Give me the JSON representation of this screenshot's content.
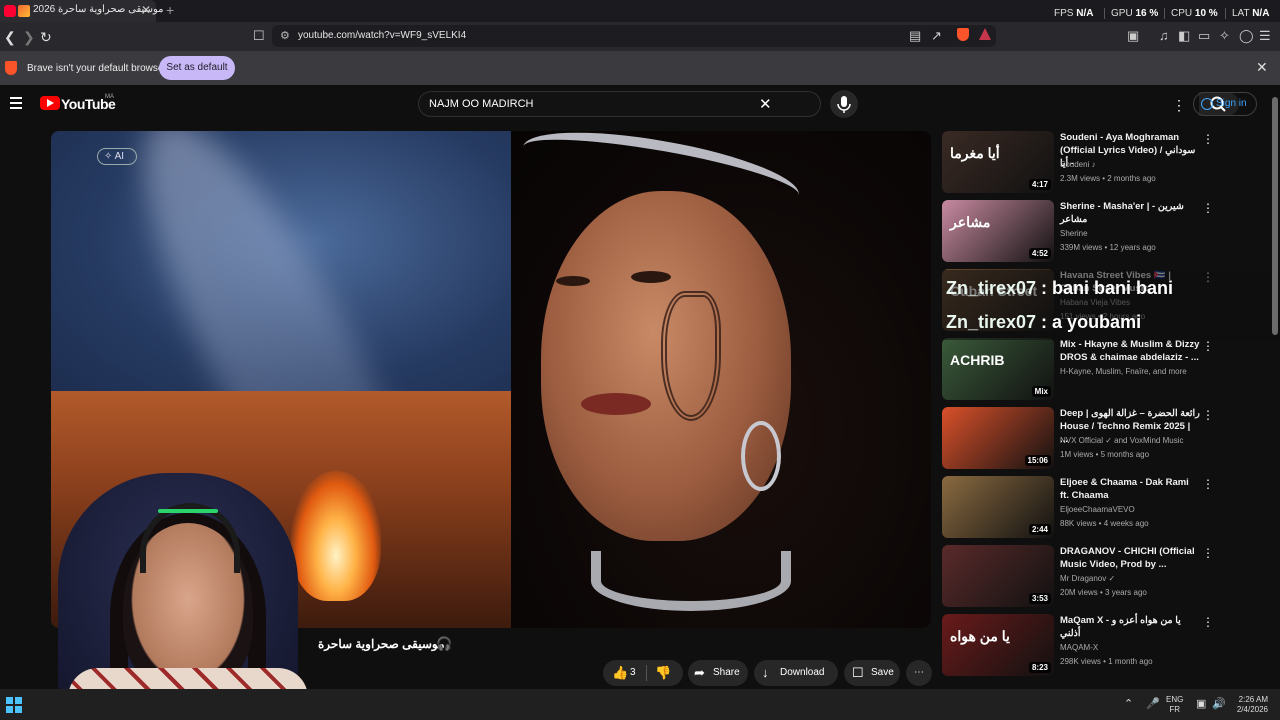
{
  "browser": {
    "tab_title": "موسيقى صحراوية ساحرة 2026",
    "tab_close": "✕",
    "new_tab": "+",
    "perf": {
      "fps_label": "FPS",
      "fps_value": "N/A",
      "gpu_label": "GPU",
      "gpu_value": "16 %",
      "cpu_label": "CPU",
      "cpu_value": "10 %",
      "lat_label": "LAT",
      "lat_value": "N/A"
    },
    "url": "youtube.com/watch?v=WF9_sVELKI4",
    "infobar_message": "Brave isn't your default browser",
    "set_default_label": "Set as default",
    "infobar_close": "✕"
  },
  "youtube": {
    "logo_text": "YouTube",
    "country_code": "MA",
    "search_query": "NAJM OO MADIRCH",
    "signin_label": "Sign in",
    "player": {
      "ai_badge": "AI"
    },
    "video_title": "موسيقى صحراوية ساحرة",
    "actions": {
      "like_count": "3",
      "share_label": "Share",
      "download_label": "Download",
      "save_label": "Save"
    },
    "recommendations": [
      {
        "title": "Soudeni - Aya Moghraman (Official Lyrics Video) / سوداني - أيا",
        "channel": "Soudeni ♪",
        "meta": "2.3M views • 2 months ago",
        "duration": "4:17",
        "thumb_text": "أيا مغرما",
        "thumb_color": "#3a2a24"
      },
      {
        "title": "Sherine - Masha'er | شيرين - مشاعر",
        "channel": "Sherine",
        "meta": "339M views • 12 years ago",
        "duration": "4:52",
        "thumb_text": "مشاعر",
        "thumb_color": "#c88aa0"
      },
      {
        "title": "Havana Street Vibes 🇨🇺 | Cuban Street Music",
        "channel": "Habana Vieja Vibes",
        "meta": "151 views • 2 hours ago",
        "duration": "",
        "thumb_text": "Cuban Street",
        "thumb_color": "#6a4a30"
      },
      {
        "title": "Mix - Hkayne & Muslim & Dizzy DROS & chaimae abdelaziz - ...",
        "channel": "H-Kayne, Muslim, Fnaïre, and more",
        "meta": "",
        "duration": "Mix",
        "thumb_text": "ACHRIB",
        "thumb_color": "#3a5a3a"
      },
      {
        "title": "Deep | رائعة الحضرة – غزالة الهوى House / Techno Remix 2025 | ...",
        "channel": "NVX Official ✓ and VoxMind Music",
        "meta": "1M views • 5 months ago",
        "duration": "15:06",
        "thumb_text": "",
        "thumb_color": "#d9502a"
      },
      {
        "title": "Eljoee & Chaama - Dak Rami ft. Chaama",
        "channel": "EljoeeChaamaVEVO",
        "meta": "88K views • 4 weeks ago",
        "duration": "2:44",
        "thumb_text": "",
        "thumb_color": "#8a6a40"
      },
      {
        "title": "DRAGANOV - CHICHI (Official Music Video, Prod by ...",
        "channel": "Mr Draganov ✓",
        "meta": "20M views • 3 years ago",
        "duration": "3:53",
        "thumb_text": "",
        "thumb_color": "#5a2a2a"
      },
      {
        "title": "MaQam X - يا من هواه أعزه و أذلني",
        "channel": "MAQAM-X",
        "meta": "298K views • 1 month ago",
        "duration": "8:23",
        "thumb_text": "يا من هواه",
        "thumb_color": "#6a1a1a"
      }
    ]
  },
  "chat": [
    {
      "user": "Zn_tirex07",
      "sep": " : ",
      "message": "bani bani bani"
    },
    {
      "user": "Zn_tirex07",
      "sep": " : ",
      "message": "a youbami"
    }
  ],
  "taskbar": {
    "lang_top": "ENG",
    "lang_bottom": "FR",
    "time": "2:26 AM",
    "date": "2/4/2026"
  },
  "colors": {
    "youtube_red": "#ff0000",
    "brave_orange": "#fb542b",
    "signin_blue": "#3ea6ff",
    "set_default_bg": "#c9b8f7"
  }
}
